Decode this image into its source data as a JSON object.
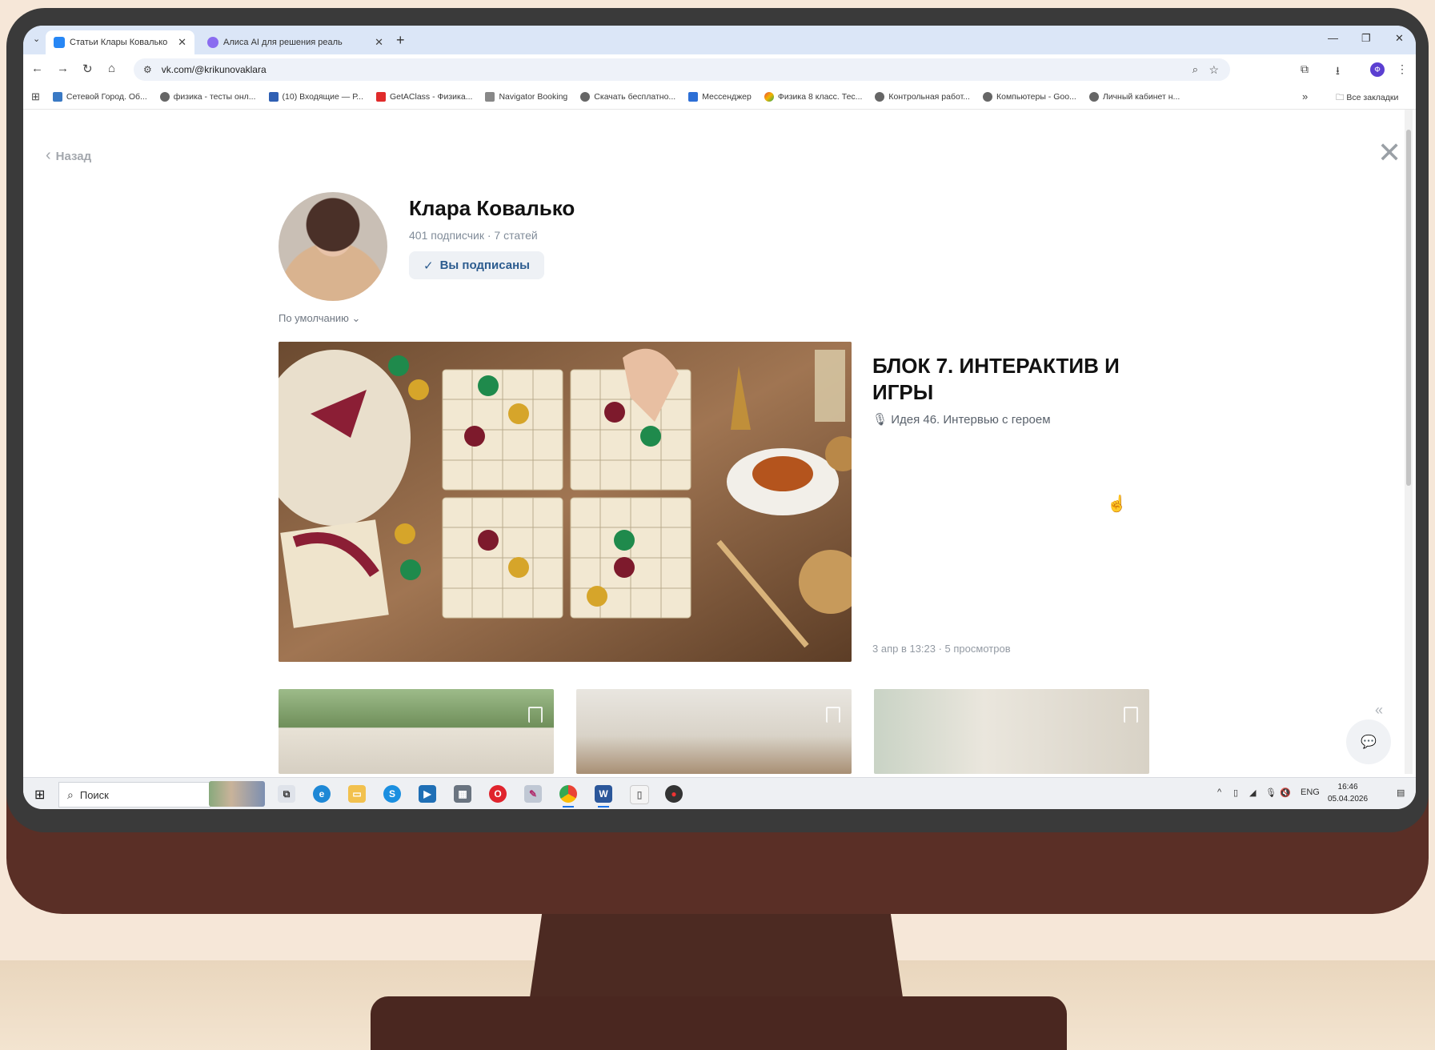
{
  "browser": {
    "tabs": [
      {
        "label": "Статьи Клары Ковалько",
        "active": true
      },
      {
        "label": "Алиса AI для решения реаль",
        "active": false
      }
    ],
    "url": "vk.com/@krikunovaklara",
    "bookmarks": [
      {
        "label": "Сетевой Город. Об..."
      },
      {
        "label": "физика - тесты онл..."
      },
      {
        "label": "(10) Входящие — Р..."
      },
      {
        "label": "GetAClass - Физика..."
      },
      {
        "label": "Navigator Booking"
      },
      {
        "label": "Скачать бесплатно..."
      },
      {
        "label": "Мессенджер"
      },
      {
        "label": "Физика 8 класс. Тес..."
      },
      {
        "label": "Контрольная работ..."
      },
      {
        "label": "Компьютеры - Goo..."
      },
      {
        "label": "Личный кабинет н..."
      }
    ],
    "all_bookmarks": "Все закладки",
    "more": "»",
    "profile_initial": "Ф"
  },
  "page": {
    "back": "Назад",
    "author": {
      "name": "Клара Ковалько",
      "stats": "401 подписчик · 7 статей",
      "subscribed_label": "Вы подписаны"
    },
    "sort_label": "По умолчанию",
    "featured": {
      "title": "БЛОК 7. ИНТЕРАКТИВ И ИГРЫ",
      "subtitle": "🎙 Идея 46. Интервью с героем",
      "meta": "3 апр в 13:23 · 5 просмотров"
    }
  },
  "taskbar": {
    "search_label": "Поиск",
    "lang": "ENG",
    "time": "16:46",
    "date": "05.04.2026"
  },
  "colors": {
    "accent": "#2c5c8f",
    "tab_strip": "#dbe6f7",
    "monitor_chin": "#5a2f26",
    "background": "#f6e7d8"
  }
}
